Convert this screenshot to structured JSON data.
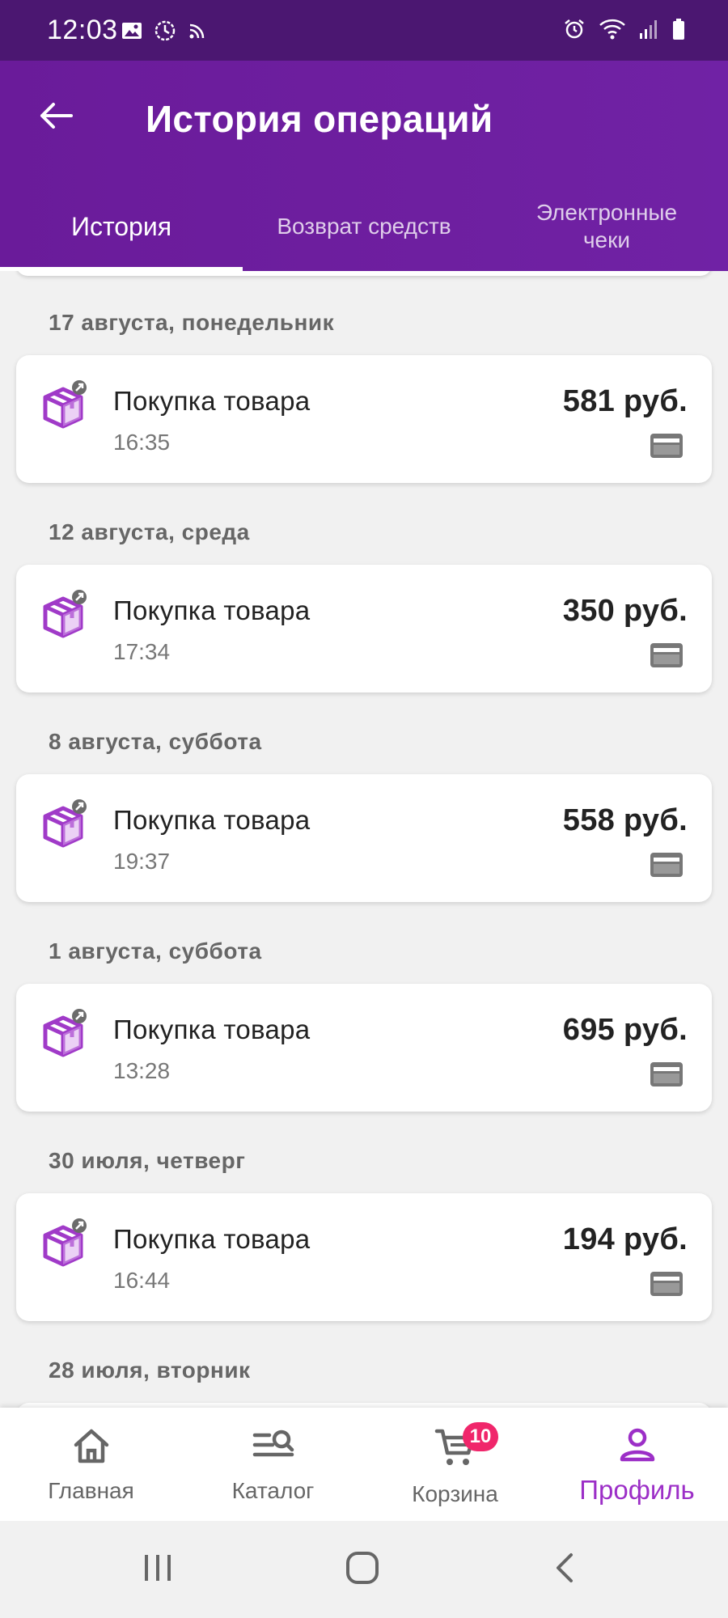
{
  "status_bar": {
    "time": "12:03",
    "left_icons": [
      "image-icon",
      "clock-icon",
      "cast-icon"
    ],
    "right_icons": [
      "alarm-icon",
      "wifi-icon",
      "signal-icon",
      "battery-icon"
    ]
  },
  "app_bar": {
    "title": "История операций",
    "back_icon": "arrow-left-icon",
    "tabs": [
      {
        "label": "История",
        "active": true
      },
      {
        "label": "Возврат средств",
        "active": false
      },
      {
        "label": "Электронные\nчеки",
        "active": false
      }
    ]
  },
  "groups": [
    {
      "date": "17 августа, понедельник",
      "items": [
        {
          "name": "Покупка товара",
          "time": "16:35",
          "amount": "581 руб."
        }
      ]
    },
    {
      "date": "12 августа, среда",
      "items": [
        {
          "name": "Покупка товара",
          "time": "17:34",
          "amount": "350 руб."
        }
      ]
    },
    {
      "date": "8 августа, суббота",
      "items": [
        {
          "name": "Покупка товара",
          "time": "19:37",
          "amount": "558 руб."
        }
      ]
    },
    {
      "date": "1 августа, суббота",
      "items": [
        {
          "name": "Покупка товара",
          "time": "13:28",
          "amount": "695 руб."
        }
      ]
    },
    {
      "date": "30 июля, четверг",
      "items": [
        {
          "name": "Покупка товара",
          "time": "16:44",
          "amount": "194 руб."
        }
      ]
    },
    {
      "date": "28 июля, вторник",
      "items": []
    }
  ],
  "bottom_nav": {
    "items": [
      {
        "label": "Главная",
        "icon": "home-icon"
      },
      {
        "label": "Каталог",
        "icon": "catalog-search-icon"
      },
      {
        "label": "Корзина",
        "icon": "cart-icon",
        "badge": "10"
      },
      {
        "label": "Профиль",
        "icon": "profile-icon",
        "active": true
      }
    ]
  },
  "colors": {
    "accent": "#6a1b9a",
    "active_nav": "#9c2fc7",
    "badge": "#f0266b",
    "box_icon": "#a03ac8"
  }
}
